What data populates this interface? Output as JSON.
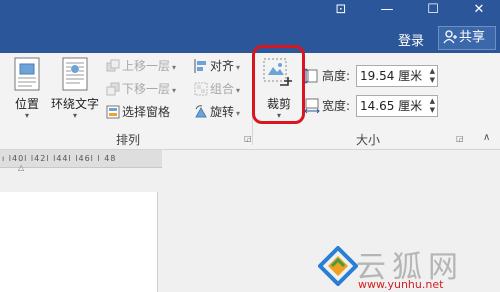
{
  "window": {
    "controls": [
      "⊡",
      "—",
      "☐",
      "✕"
    ],
    "login_label": "登录",
    "share_label": "共享"
  },
  "ribbon": {
    "position_label": "位置",
    "wrap_text_label": "环绕文字",
    "bring_forward_label": "上移一层",
    "send_backward_label": "下移一层",
    "selection_pane_label": "选择窗格",
    "align_label": "对齐",
    "group_label": "组合",
    "rotate_label": "旋转",
    "arrange_group_label": "排列",
    "crop_label": "裁剪",
    "height_label": "高度:",
    "height_value": "19.54 厘米",
    "width_label": "宽度:",
    "width_value": "14.65 厘米",
    "size_group_label": "大小"
  },
  "ruler": {
    "text": "ı l40l l42l l44l l46l l 48"
  },
  "watermark": {
    "text": "云狐网",
    "url": "www.yunhu.net"
  },
  "colors": {
    "titlebar": "#2b579a",
    "highlight": "#d9161e"
  }
}
